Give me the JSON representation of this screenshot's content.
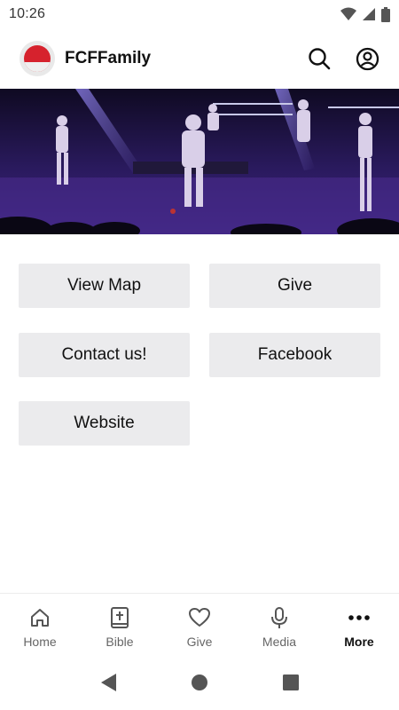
{
  "status_bar": {
    "time": "10:26"
  },
  "app_bar": {
    "title": "FCFFamily"
  },
  "hero": {
    "image": "worship-band-stage-photo"
  },
  "tiles": [
    {
      "label": "View Map"
    },
    {
      "label": "Give"
    },
    {
      "label": "Contact us!"
    },
    {
      "label": "Facebook"
    },
    {
      "label": "Website"
    }
  ],
  "bottom_nav": {
    "items": [
      {
        "label": "Home",
        "icon": "home-icon"
      },
      {
        "label": "Bible",
        "icon": "bible-icon"
      },
      {
        "label": "Give",
        "icon": "heart-icon"
      },
      {
        "label": "Media",
        "icon": "microphone-icon"
      },
      {
        "label": "More",
        "icon": "more-icon"
      }
    ],
    "active": "More"
  },
  "colors": {
    "accent": "#d6222d",
    "tile_bg": "#ebebed",
    "hero_bg": "#1a0f3a"
  }
}
